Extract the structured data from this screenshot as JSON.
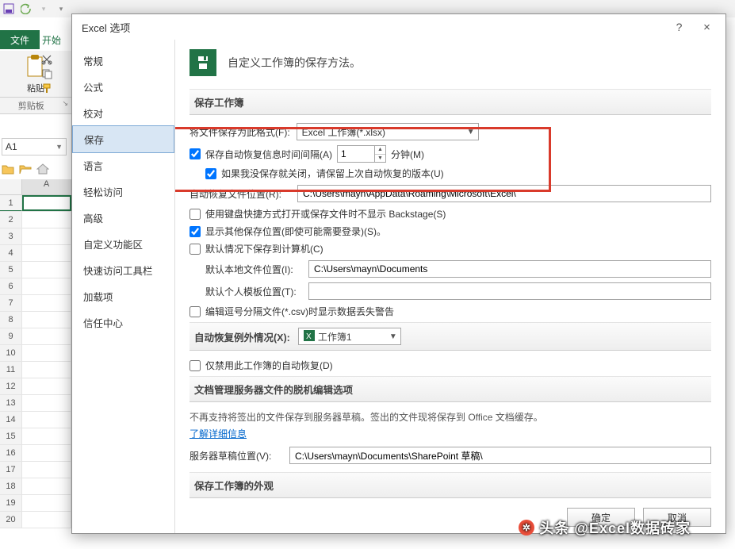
{
  "qat": {
    "a1": "A1"
  },
  "ribbon": {
    "file": "文件",
    "home": "开始",
    "paste": "粘贴",
    "clipboard_group": "剪贴板"
  },
  "grid": {
    "colA": "A"
  },
  "dialog": {
    "title": "Excel 选项",
    "help": "?",
    "close": "×",
    "sidebar": [
      "常规",
      "公式",
      "校对",
      "保存",
      "语言",
      "轻松访问",
      "高级",
      "自定义功能区",
      "快速访问工具栏",
      "加载项",
      "信任中心"
    ],
    "header": "自定义工作簿的保存方法。",
    "sec_save": "保存工作簿",
    "format_label": "将文件保存为此格式(F):",
    "format_value": "Excel 工作簿(*.xlsx)",
    "autosave_label": "保存自动恢复信息时间间隔(A)",
    "autosave_value": "1",
    "minutes": "分钟(M)",
    "keep_last_label": "如果我没保存就关闭，请保留上次自动恢复的版本(U)",
    "autorec_loc_label": "自动恢复文件位置(R):",
    "autorec_loc_value": "C:\\Users\\mayn\\AppData\\Roaming\\Microsoft\\Excel\\",
    "kb_backstage_label": "使用键盘快捷方式打开或保存文件时不显示 Backstage(S)",
    "show_other_loc_label": "显示其他保存位置(即使可能需要登录)(S)。",
    "save_to_pc_label": "默认情况下保存到计算机(C)",
    "default_loc_label": "默认本地文件位置(I):",
    "default_loc_value": "C:\\Users\\mayn\\Documents",
    "default_tpl_label": "默认个人模板位置(T):",
    "default_tpl_value": "",
    "csv_warn_label": "编辑逗号分隔文件(*.csv)时显示数据丢失警告",
    "sec_except": "自动恢复例外情况(X):",
    "except_value": "工作簿1",
    "disable_autorec_label": "仅禁用此工作簿的自动恢复(D)",
    "sec_offline": "文档管理服务器文件的脱机编辑选项",
    "offline_note": "不再支持将签出的文件保存到服务器草稿。签出的文件现将保存到 Office 文档缓存。",
    "learn_more": "了解详细信息",
    "server_draft_label": "服务器草稿位置(V):",
    "server_draft_value": "C:\\Users\\mayn\\Documents\\SharePoint 草稿\\",
    "sec_appearance": "保存工作簿的外观",
    "ok": "确定",
    "cancel": "取消"
  },
  "watermark": "头条 @Excel数据砖家"
}
